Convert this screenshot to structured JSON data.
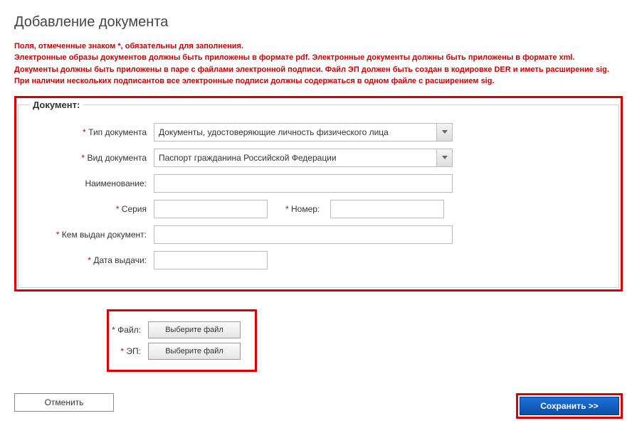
{
  "title": "Добавление документа",
  "instructions": [
    "Поля, отмеченные знаком *, обязательны для заполнения.",
    "Электронные образы документов должны быть приложены в формате pdf. Электронные документы должны быть приложены в формате xml.",
    "Документы должны быть приложены в паре с файлами электронной подписи. Файл ЭП должен быть создан в кодировке DER и иметь расширение sig.",
    "При наличии нескольких подписантов все электронные подписи должны содержаться в одном файле с расширением sig."
  ],
  "fieldset_legend": "Документ:",
  "labels": {
    "doc_type": "Тип документа",
    "doc_kind": "Вид документа",
    "name": "Наименование:",
    "series": "Серия",
    "number": "Номер:",
    "issued_by": "Кем выдан документ:",
    "issue_date": "Дата выдачи:",
    "file": "Файл:",
    "ep": "ЭП:"
  },
  "values": {
    "doc_type": "Документы, удостоверяющие личность физического лица",
    "doc_kind": "Паспорт гражданина Российской Федерации",
    "name": "",
    "series": "",
    "number": "",
    "issued_by": "",
    "issue_date": ""
  },
  "buttons": {
    "choose_file": "Выберите файл",
    "cancel": "Отменить",
    "save": "Сохранить >>"
  }
}
